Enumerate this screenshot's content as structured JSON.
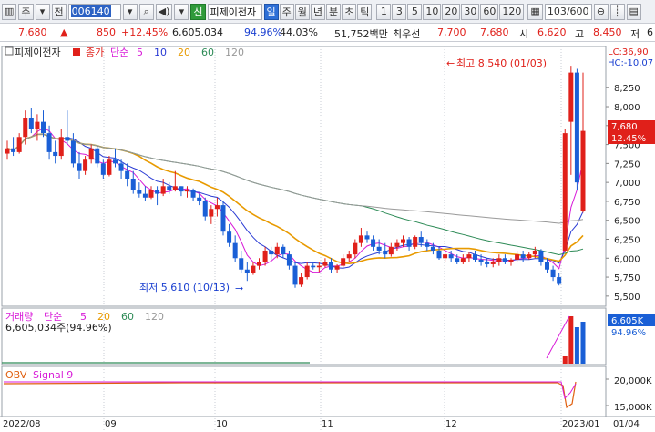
{
  "toolbar": {
    "mode": "주",
    "prefix": "전",
    "code": "006140",
    "name_btn": "신",
    "name": "피제이전자",
    "periods": [
      "일",
      "주",
      "월",
      "년",
      "분",
      "초",
      "틱"
    ],
    "selected_period": "일",
    "intervals": [
      "1",
      "3",
      "5",
      "10",
      "20",
      "30",
      "60",
      "120"
    ],
    "count": "103/600"
  },
  "quote": {
    "price": "7,680",
    "change_arrow": "▲",
    "change": "850",
    "change_pct": "+12.45%",
    "volume": "6,605,034",
    "vol_ratio": "94.96%",
    "turnover_ratio": "44.03%",
    "amount": "51,752백만",
    "pref_label": "최우선",
    "ask": "7,700",
    "bid": "7,680",
    "open_label": "시",
    "open": "6,620",
    "high_label": "고",
    "high": "8,450",
    "low_label": "저",
    "low": "6"
  },
  "price_panel": {
    "tag": "피제이전자",
    "legend_close": "종가",
    "legend_ma": "단순",
    "ma_periods": [
      "5",
      "10",
      "20",
      "60",
      "120"
    ],
    "ma_colors": [
      "#d81bd8",
      "#2a3bd4",
      "#e89a00",
      "#2e8b57",
      "#999999"
    ],
    "lc": "LC:36,90",
    "hc": "HC:-10,07",
    "high_note": "최고 8,540 (01/03)",
    "low_note": "최저 5,610 (10/13)",
    "price_tag": "7,680",
    "pct_tag": "12.45%",
    "y_ticks": [
      "8,250",
      "8,000",
      "7,750",
      "7,500",
      "7,250",
      "7,000",
      "6,750",
      "6,500",
      "6,250",
      "6,000",
      "5,750",
      "5,500"
    ]
  },
  "volume_panel": {
    "label": "거래량",
    "ma": "단순",
    "ma_periods": [
      "5",
      "20",
      "60",
      "120"
    ],
    "ma_colors": [
      "#d81bd8",
      "#e89a00",
      "#2e8b57",
      "#999999"
    ],
    "value": "6,605,034주(94.96%)",
    "tag": "6,605K",
    "pct": "94.96%"
  },
  "obv_panel": {
    "label": "OBV",
    "signal": "Signal 9",
    "y_ticks": [
      "20,000K",
      "15,000K"
    ]
  },
  "x_axis": [
    "2022/08",
    "09",
    "10",
    "11",
    "12",
    "2023/01",
    "01/04"
  ],
  "colors": {
    "up": "#e0201a",
    "down": "#1a5fd6",
    "accent": "#2e6fd6"
  },
  "chart_data": {
    "type": "candlestick",
    "title": "피제이전자",
    "ylim": [
      5400,
      8550
    ],
    "candles": [
      {
        "o": 7380,
        "h": 7550,
        "l": 7300,
        "c": 7450
      },
      {
        "o": 7450,
        "h": 7600,
        "l": 7350,
        "c": 7400
      },
      {
        "o": 7400,
        "h": 7650,
        "l": 7380,
        "c": 7600
      },
      {
        "o": 7600,
        "h": 7950,
        "l": 7500,
        "c": 7850
      },
      {
        "o": 7850,
        "h": 7980,
        "l": 7650,
        "c": 7700
      },
      {
        "o": 7700,
        "h": 7900,
        "l": 7550,
        "c": 7800
      },
      {
        "o": 7800,
        "h": 7950,
        "l": 7600,
        "c": 7650
      },
      {
        "o": 7650,
        "h": 7750,
        "l": 7300,
        "c": 7400
      },
      {
        "o": 7400,
        "h": 7550,
        "l": 7250,
        "c": 7350
      },
      {
        "o": 7350,
        "h": 7700,
        "l": 7300,
        "c": 7600
      },
      {
        "o": 7600,
        "h": 7950,
        "l": 7500,
        "c": 7550
      },
      {
        "o": 7550,
        "h": 7650,
        "l": 7200,
        "c": 7250
      },
      {
        "o": 7250,
        "h": 7400,
        "l": 7050,
        "c": 7150
      },
      {
        "o": 7150,
        "h": 7350,
        "l": 7100,
        "c": 7300
      },
      {
        "o": 7300,
        "h": 7500,
        "l": 7250,
        "c": 7450
      },
      {
        "o": 7450,
        "h": 7480,
        "l": 7200,
        "c": 7250
      },
      {
        "o": 7250,
        "h": 7300,
        "l": 7050,
        "c": 7100
      },
      {
        "o": 7100,
        "h": 7350,
        "l": 7080,
        "c": 7300
      },
      {
        "o": 7300,
        "h": 7450,
        "l": 7200,
        "c": 7250
      },
      {
        "o": 7250,
        "h": 7300,
        "l": 7050,
        "c": 7150
      },
      {
        "o": 7150,
        "h": 7250,
        "l": 6950,
        "c": 7050
      },
      {
        "o": 7050,
        "h": 7150,
        "l": 6850,
        "c": 6900
      },
      {
        "o": 6900,
        "h": 7000,
        "l": 6800,
        "c": 6850
      },
      {
        "o": 6850,
        "h": 6950,
        "l": 6750,
        "c": 6800
      },
      {
        "o": 6800,
        "h": 6950,
        "l": 6780,
        "c": 6900
      },
      {
        "o": 6900,
        "h": 6950,
        "l": 6700,
        "c": 6850
      },
      {
        "o": 6850,
        "h": 7050,
        "l": 6820,
        "c": 6950
      },
      {
        "o": 6950,
        "h": 7000,
        "l": 6850,
        "c": 6900
      },
      {
        "o": 6900,
        "h": 7150,
        "l": 6880,
        "c": 6950
      },
      {
        "o": 6950,
        "h": 6950,
        "l": 6820,
        "c": 6880
      },
      {
        "o": 6880,
        "h": 6950,
        "l": 6800,
        "c": 6900
      },
      {
        "o": 6900,
        "h": 6920,
        "l": 6750,
        "c": 6800
      },
      {
        "o": 6800,
        "h": 6850,
        "l": 6700,
        "c": 6750
      },
      {
        "o": 6750,
        "h": 6800,
        "l": 6500,
        "c": 6550
      },
      {
        "o": 6550,
        "h": 6700,
        "l": 6450,
        "c": 6650
      },
      {
        "o": 6650,
        "h": 6800,
        "l": 6550,
        "c": 6700
      },
      {
        "o": 6700,
        "h": 6750,
        "l": 6300,
        "c": 6350
      },
      {
        "o": 6350,
        "h": 6450,
        "l": 6150,
        "c": 6200
      },
      {
        "o": 6200,
        "h": 6300,
        "l": 5950,
        "c": 6000
      },
      {
        "o": 6000,
        "h": 6100,
        "l": 5800,
        "c": 5850
      },
      {
        "o": 5850,
        "h": 5950,
        "l": 5700,
        "c": 5800
      },
      {
        "o": 5800,
        "h": 5950,
        "l": 5780,
        "c": 5900
      },
      {
        "o": 5900,
        "h": 6000,
        "l": 5850,
        "c": 5950
      },
      {
        "o": 5950,
        "h": 6150,
        "l": 5900,
        "c": 6100
      },
      {
        "o": 6100,
        "h": 6150,
        "l": 5980,
        "c": 6050
      },
      {
        "o": 6050,
        "h": 6200,
        "l": 6000,
        "c": 6150
      },
      {
        "o": 6150,
        "h": 6180,
        "l": 6000,
        "c": 6050
      },
      {
        "o": 6050,
        "h": 6100,
        "l": 5850,
        "c": 5900
      },
      {
        "o": 5900,
        "h": 5950,
        "l": 5610,
        "c": 5650
      },
      {
        "o": 5650,
        "h": 5800,
        "l": 5620,
        "c": 5750
      },
      {
        "o": 5750,
        "h": 5950,
        "l": 5720,
        "c": 5900
      },
      {
        "o": 5900,
        "h": 5950,
        "l": 5850,
        "c": 5880
      },
      {
        "o": 5880,
        "h": 5950,
        "l": 5820,
        "c": 5900
      },
      {
        "o": 5900,
        "h": 6000,
        "l": 5880,
        "c": 5950
      },
      {
        "o": 5950,
        "h": 6000,
        "l": 5800,
        "c": 5850
      },
      {
        "o": 5850,
        "h": 5920,
        "l": 5800,
        "c": 5900
      },
      {
        "o": 5900,
        "h": 6050,
        "l": 5880,
        "c": 6000
      },
      {
        "o": 6000,
        "h": 6100,
        "l": 5950,
        "c": 6050
      },
      {
        "o": 6050,
        "h": 6250,
        "l": 6000,
        "c": 6200
      },
      {
        "o": 6200,
        "h": 6400,
        "l": 6150,
        "c": 6300
      },
      {
        "o": 6300,
        "h": 6350,
        "l": 6200,
        "c": 6250
      },
      {
        "o": 6250,
        "h": 6300,
        "l": 6100,
        "c": 6150
      },
      {
        "o": 6150,
        "h": 6250,
        "l": 6050,
        "c": 6100
      },
      {
        "o": 6100,
        "h": 6200,
        "l": 6000,
        "c": 6050
      },
      {
        "o": 6050,
        "h": 6200,
        "l": 6020,
        "c": 6150
      },
      {
        "o": 6150,
        "h": 6250,
        "l": 6100,
        "c": 6200
      },
      {
        "o": 6200,
        "h": 6300,
        "l": 6150,
        "c": 6250
      },
      {
        "o": 6250,
        "h": 6280,
        "l": 6100,
        "c": 6150
      },
      {
        "o": 6150,
        "h": 6300,
        "l": 6120,
        "c": 6280
      },
      {
        "o": 6280,
        "h": 6350,
        "l": 6150,
        "c": 6200
      },
      {
        "o": 6200,
        "h": 6250,
        "l": 6100,
        "c": 6150
      },
      {
        "o": 6150,
        "h": 6200,
        "l": 6050,
        "c": 6100
      },
      {
        "o": 6100,
        "h": 6150,
        "l": 5980,
        "c": 6000
      },
      {
        "o": 6000,
        "h": 6080,
        "l": 5950,
        "c": 6050
      },
      {
        "o": 6050,
        "h": 6100,
        "l": 5950,
        "c": 6000
      },
      {
        "o": 6000,
        "h": 6050,
        "l": 5920,
        "c": 5950
      },
      {
        "o": 5950,
        "h": 6050,
        "l": 5920,
        "c": 6000
      },
      {
        "o": 6000,
        "h": 6080,
        "l": 5950,
        "c": 6050
      },
      {
        "o": 6050,
        "h": 6100,
        "l": 5950,
        "c": 5980
      },
      {
        "o": 5980,
        "h": 6050,
        "l": 5900,
        "c": 5950
      },
      {
        "o": 5950,
        "h": 6000,
        "l": 5880,
        "c": 5920
      },
      {
        "o": 5920,
        "h": 6000,
        "l": 5880,
        "c": 5950
      },
      {
        "o": 5950,
        "h": 6050,
        "l": 5900,
        "c": 6000
      },
      {
        "o": 6000,
        "h": 6050,
        "l": 5920,
        "c": 5950
      },
      {
        "o": 5950,
        "h": 6000,
        "l": 5900,
        "c": 5980
      },
      {
        "o": 5980,
        "h": 6100,
        "l": 5950,
        "c": 6050
      },
      {
        "o": 6050,
        "h": 6100,
        "l": 5950,
        "c": 6000
      },
      {
        "o": 6000,
        "h": 6080,
        "l": 5980,
        "c": 6050
      },
      {
        "o": 6050,
        "h": 6150,
        "l": 6000,
        "c": 6100
      },
      {
        "o": 6100,
        "h": 6120,
        "l": 5900,
        "c": 5950
      },
      {
        "o": 5950,
        "h": 6000,
        "l": 5800,
        "c": 5850
      },
      {
        "o": 5850,
        "h": 5900,
        "l": 5700,
        "c": 5750
      },
      {
        "o": 5750,
        "h": 5800,
        "l": 5640,
        "c": 5660
      },
      {
        "o": 6100,
        "h": 7700,
        "l": 6080,
        "c": 7650
      },
      {
        "o": 7800,
        "h": 8540,
        "l": 7100,
        "c": 8450
      },
      {
        "o": 8450,
        "h": 8500,
        "l": 6900,
        "c": 7000
      },
      {
        "o": 6620,
        "h": 8450,
        "l": 6600,
        "c": 7680
      }
    ],
    "volume_last": 6605034
  }
}
